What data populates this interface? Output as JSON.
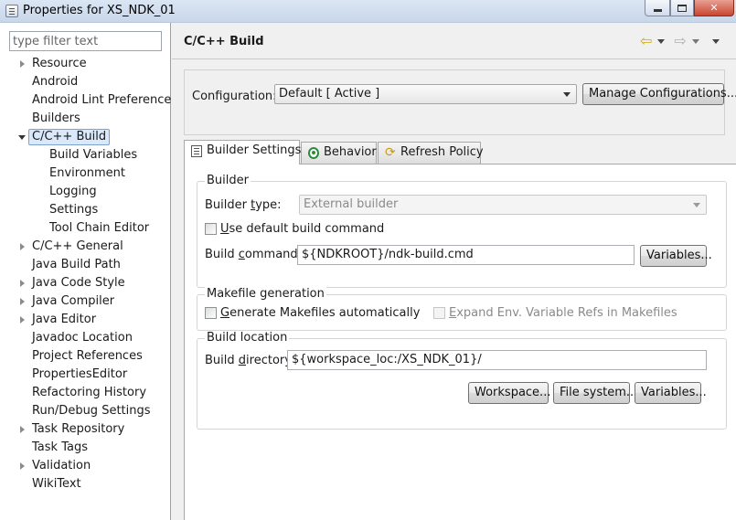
{
  "window": {
    "title": "Properties for XS_NDK_01",
    "close_glyph": "✕"
  },
  "filter": {
    "placeholder": "type filter text"
  },
  "tree": [
    {
      "label": "Resource",
      "expandable": true
    },
    {
      "label": "Android",
      "expandable": false
    },
    {
      "label": "Android Lint Preferences",
      "expandable": false
    },
    {
      "label": "Builders",
      "expandable": false
    },
    {
      "label": "C/C++ Build",
      "expandable": true,
      "expanded": true,
      "selected": true
    },
    {
      "label": "Build Variables",
      "child": true
    },
    {
      "label": "Environment",
      "child": true
    },
    {
      "label": "Logging",
      "child": true
    },
    {
      "label": "Settings",
      "child": true
    },
    {
      "label": "Tool Chain Editor",
      "child": true
    },
    {
      "label": "C/C++ General",
      "expandable": true
    },
    {
      "label": "Java Build Path",
      "expandable": false
    },
    {
      "label": "Java Code Style",
      "expandable": true
    },
    {
      "label": "Java Compiler",
      "expandable": true
    },
    {
      "label": "Java Editor",
      "expandable": true
    },
    {
      "label": "Javadoc Location",
      "expandable": false
    },
    {
      "label": "Project References",
      "expandable": false
    },
    {
      "label": "PropertiesEditor",
      "expandable": false
    },
    {
      "label": "Refactoring History",
      "expandable": false
    },
    {
      "label": "Run/Debug Settings",
      "expandable": false
    },
    {
      "label": "Task Repository",
      "expandable": true
    },
    {
      "label": "Task Tags",
      "expandable": false
    },
    {
      "label": "Validation",
      "expandable": true
    },
    {
      "label": "WikiText",
      "expandable": false
    }
  ],
  "page": {
    "title": "C/C++ Build",
    "back_arrow": "⇦",
    "forward_arrow": "⇨"
  },
  "configuration": {
    "label": "Configuration:",
    "value": "Default  [ Active ]",
    "manage_button": "Manage Configurations..."
  },
  "tabs": [
    {
      "label": "Builder Settings",
      "icon": "list-icon",
      "active": true
    },
    {
      "label": "Behavior",
      "icon": "behavior-icon",
      "active": false
    },
    {
      "label": "Refresh Policy",
      "icon": "refresh-icon",
      "active": false
    }
  ],
  "builder": {
    "legend": "Builder",
    "type_label_pre": "Builder ",
    "type_label_u": "t",
    "type_label_post": "ype:",
    "type_value": "External builder",
    "use_default_u": "U",
    "use_default_rest": "se default build command",
    "command_label_pre": "Build ",
    "command_label_u": "c",
    "command_label_post": "ommand:",
    "command_value": "${NDKROOT}/ndk-build.cmd",
    "variables_button": "Variables..."
  },
  "makefile": {
    "legend": "Makefile generation",
    "generate_u": "G",
    "generate_rest": "enerate Makefiles automatically",
    "expand_u": "E",
    "expand_rest": "xpand Env. Variable Refs in Makefiles"
  },
  "location": {
    "legend": "Build location",
    "dir_label_pre": "Build ",
    "dir_label_u": "d",
    "dir_label_post": "irectory:",
    "dir_value": "${workspace_loc:/XS_NDK_01}/",
    "workspace_button": "Workspace...",
    "filesystem_button": "File system...",
    "variables_button": "Variables..."
  }
}
